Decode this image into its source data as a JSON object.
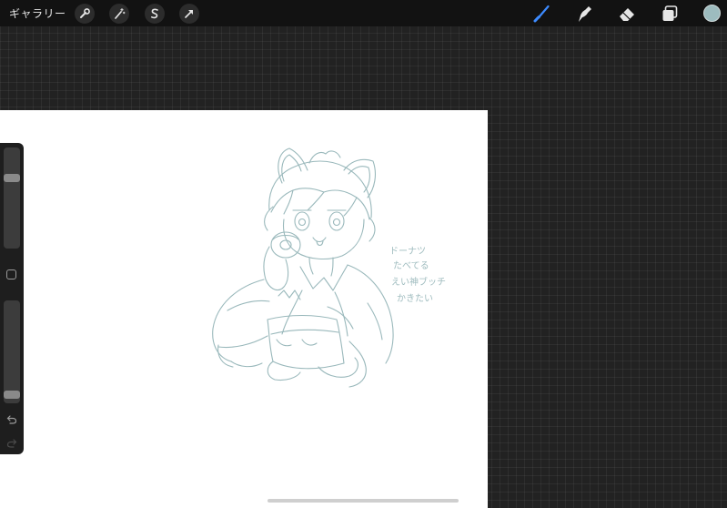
{
  "topbar": {
    "gallery_label": "ギャラリー",
    "left_tools": [
      {
        "icon": "wrench-icon",
        "name": "actions"
      },
      {
        "icon": "magic-wand-icon",
        "name": "adjustments"
      },
      {
        "icon": "selection-s-icon",
        "name": "selection"
      },
      {
        "icon": "arrow-cursor-icon",
        "name": "transform"
      }
    ],
    "right_tools": [
      {
        "icon": "brush-icon",
        "name": "paint",
        "active": true
      },
      {
        "icon": "smudge-icon",
        "name": "smudge"
      },
      {
        "icon": "eraser-icon",
        "name": "erase"
      },
      {
        "icon": "layers-icon",
        "name": "layers"
      }
    ],
    "current_color": "#9dbcbf",
    "active_tool_color": "#3d8bff"
  },
  "sidebar": {
    "brush_size_level": 0.72,
    "opacity_level": 0.05,
    "undo_icon": "undo-arrow-icon",
    "redo_icon": "redo-arrow-icon"
  },
  "canvas": {
    "background": "#ffffff",
    "sketch_color": "#8fb1b4",
    "handwritten_note": [
      "ドーナツ",
      "たべてる",
      "えい神ブッチ",
      "かきたい"
    ]
  }
}
